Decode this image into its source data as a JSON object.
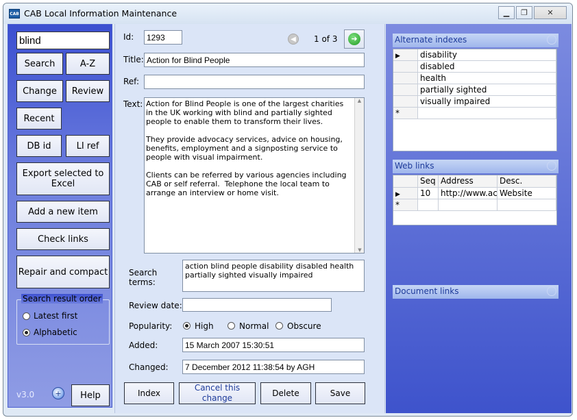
{
  "window": {
    "title": "CAB Local Information Maintenance",
    "app_icon_text": "CAB"
  },
  "left": {
    "search_value": "blind",
    "buttons": {
      "search": "Search",
      "az": "A-Z",
      "change": "Change",
      "review": "Review",
      "recent": "Recent",
      "dbid": "DB id",
      "liref": "LI ref",
      "export": "Export selected to Excel",
      "add_new": "Add a new item",
      "check_links": "Check links",
      "repair": "Repair and compact",
      "help": "Help"
    },
    "order_group": {
      "title": "Search result order",
      "options": [
        "Latest first",
        "Alphabetic"
      ],
      "selected": "Alphabetic"
    },
    "version": "v3.0"
  },
  "record": {
    "id_label": "Id:",
    "id_value": "1293",
    "nav_text": "1 of 3",
    "title_label": "Title:",
    "title_value": "Action for Blind People",
    "ref_label": "Ref:",
    "ref_value": "",
    "text_label": "Text:",
    "text_value": "Action for Blind People is one of the largest charities in the UK working with blind and partially sighted people to enable them to transform their lives.\n\nThey provide advocacy services, advice on housing, benefits, employment and a signposting service to people with visual impairment.\n\nClients can be referred by various agencies including CAB or self referral.  Telephone the local team to arrange an interview or home visit.",
    "search_terms_label": "Search terms:",
    "search_terms_value": "action blind people disability disabled health partially sighted visually impaired",
    "review_label": "Review date:",
    "review_value": "",
    "popularity_label": "Popularity:",
    "popularity_options": [
      "High",
      "Normal",
      "Obscure"
    ],
    "popularity_selected": "High",
    "added_label": "Added:",
    "added_value": "15 March 2007 15:30:51",
    "changed_label": "Changed:",
    "changed_value": "7 December 2012 11:38:54 by AGH",
    "buttons": {
      "index": "Index",
      "cancel": "Cancel this change",
      "delete": "Delete",
      "save": "Save"
    }
  },
  "right": {
    "alt_indexes": {
      "title": "Alternate indexes",
      "rows": [
        "disability",
        "disabled",
        "health",
        "partially sighted",
        "visually impaired"
      ],
      "new_row_marker": "*"
    },
    "web_links": {
      "title": "Web links",
      "columns": [
        "Seq",
        "Address",
        "Desc."
      ],
      "rows": [
        {
          "seq": "10",
          "address": "http://www.actio",
          "desc": "Website"
        }
      ],
      "new_row_marker": "*"
    },
    "doc_links": {
      "title": "Document links"
    }
  }
}
